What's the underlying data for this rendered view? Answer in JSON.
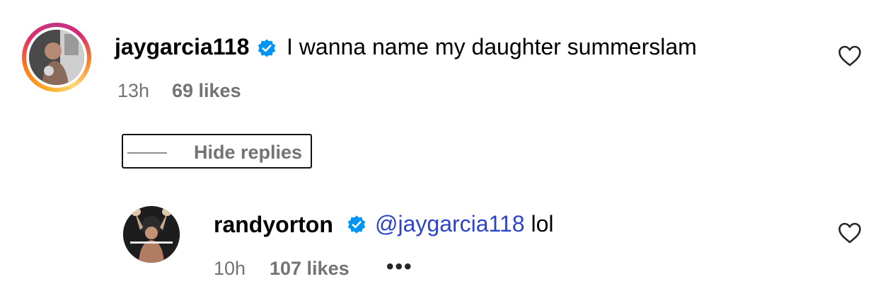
{
  "comment": {
    "username": "jaygarcia118",
    "text": "I wanna name my daughter summerslam",
    "time": "13h",
    "likes": "69 likes",
    "verified": true
  },
  "thread": {
    "hide_replies_label": "Hide replies"
  },
  "reply": {
    "username": "randyorton",
    "mention": "@jaygarcia118",
    "text": "lol",
    "time": "10h",
    "likes": "107 likes",
    "more_label": "•••",
    "verified": true
  },
  "colors": {
    "verified_badge": "#0095f6",
    "mention": "#2e44c8",
    "meta": "#737373"
  },
  "icons": [
    "verified-badge-icon",
    "heart-icon",
    "more-options-icon"
  ]
}
